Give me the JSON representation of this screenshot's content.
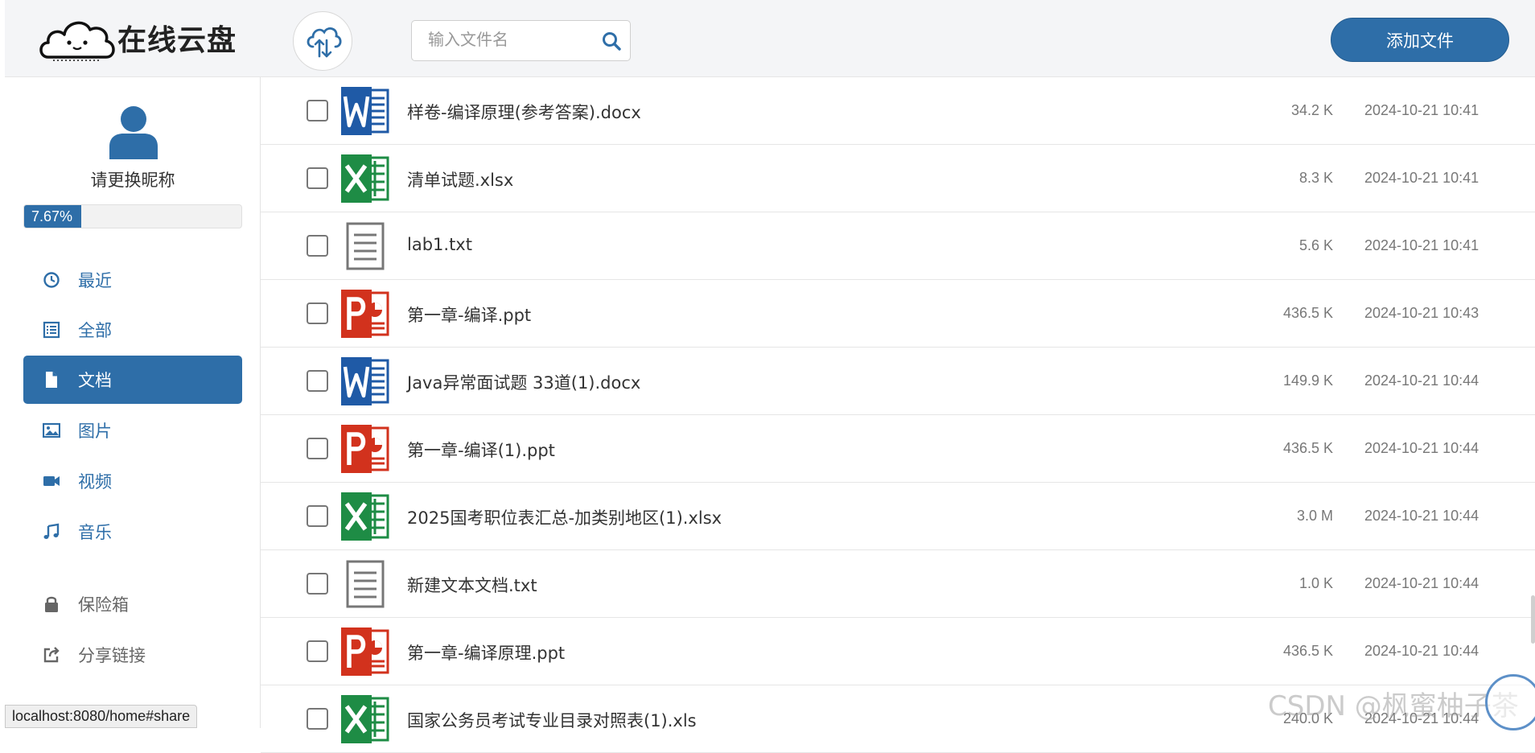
{
  "header": {
    "app_title": "在线云盘",
    "search_placeholder": "输入文件名",
    "add_file_label": "添加文件"
  },
  "user": {
    "nickname": "请更换昵称",
    "storage_used_label": "7.67%",
    "storage_used_fraction": 0.0767
  },
  "sidebar": {
    "items": [
      {
        "label": "最近",
        "icon": "clock-icon",
        "active": false
      },
      {
        "label": "全部",
        "icon": "list-icon",
        "active": false
      },
      {
        "label": "文档",
        "icon": "document-icon",
        "active": true
      },
      {
        "label": "图片",
        "icon": "image-icon",
        "active": false
      },
      {
        "label": "视频",
        "icon": "video-camera-icon",
        "active": false
      },
      {
        "label": "音乐",
        "icon": "music-note-icon",
        "active": false
      },
      {
        "label": "保险箱",
        "icon": "lock-icon",
        "active": false
      },
      {
        "label": "分享链接",
        "icon": "share-icon",
        "active": false
      }
    ]
  },
  "files": [
    {
      "name": "样卷-编译原理(参考答案).docx",
      "type": "word",
      "size": "34.2 K",
      "date": "2024-10-21 10:41"
    },
    {
      "name": "清单试题.xlsx",
      "type": "excel",
      "size": "8.3 K",
      "date": "2024-10-21 10:41"
    },
    {
      "name": "lab1.txt",
      "type": "text",
      "size": "5.6 K",
      "date": "2024-10-21 10:41"
    },
    {
      "name": "第一章-编译.ppt",
      "type": "powerpoint",
      "size": "436.5 K",
      "date": "2024-10-21 10:43"
    },
    {
      "name": "Java异常面试题 33道(1).docx",
      "type": "word",
      "size": "149.9 K",
      "date": "2024-10-21 10:44"
    },
    {
      "name": "第一章-编译(1).ppt",
      "type": "powerpoint",
      "size": "436.5 K",
      "date": "2024-10-21 10:44"
    },
    {
      "name": "2025国考职位表汇总-加类别地区(1).xlsx",
      "type": "excel",
      "size": "3.0 M",
      "date": "2024-10-21 10:44"
    },
    {
      "name": "新建文本文档.txt",
      "type": "text",
      "size": "1.0 K",
      "date": "2024-10-21 10:44"
    },
    {
      "name": "第一章-编译原理.ppt",
      "type": "powerpoint",
      "size": "436.5 K",
      "date": "2024-10-21 10:44"
    },
    {
      "name": "国家公务员考试专业目录对照表(1).xls",
      "type": "excel",
      "size": "240.0 K",
      "date": "2024-10-21 10:44"
    }
  ],
  "status_bar": {
    "url": "localhost:8080/home#share"
  },
  "watermark": "CSDN @枫蜜柚子茶",
  "colors": {
    "accent": "#2e6ea8",
    "word": "#1f5aa6",
    "excel": "#1e8c45",
    "powerpoint": "#d2321d"
  }
}
